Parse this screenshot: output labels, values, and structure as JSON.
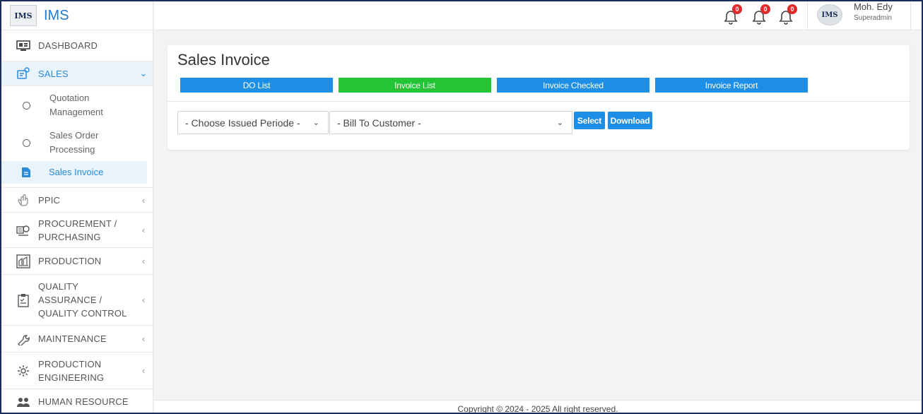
{
  "brand": {
    "logo_text": "IMS",
    "name": "IMS"
  },
  "sidebar": {
    "items": [
      {
        "label": "DASHBOARD",
        "icon": "monitor-icon"
      },
      {
        "label": "SALES",
        "icon": "sales-icon",
        "active": true
      },
      {
        "label": "PPIC",
        "icon": "hand-icon"
      },
      {
        "label": "PROCUREMENT / PURCHASING",
        "icon": "procurement-icon"
      },
      {
        "label": "PRODUCTION",
        "icon": "production-icon"
      },
      {
        "label": "QUALITY ASSURANCE / QUALITY CONTROL",
        "icon": "clipboard-icon"
      },
      {
        "label": "MAINTENANCE",
        "icon": "wrench-icon"
      },
      {
        "label": "PRODUCTION ENGINEERING",
        "icon": "gear-icon"
      },
      {
        "label": "HUMAN RESOURCE",
        "icon": "people-icon"
      }
    ],
    "sales_sub": [
      {
        "label": "Quotation Management"
      },
      {
        "label": "Sales Order Processing"
      },
      {
        "label": "Sales Invoice",
        "active": true
      }
    ]
  },
  "topbar": {
    "notifications": [
      {
        "count": "0"
      },
      {
        "count": "0"
      },
      {
        "count": "0"
      }
    ],
    "user": {
      "avatar_text": "IMS",
      "name": "Moh. Edy",
      "role": "Superadmin"
    }
  },
  "main": {
    "title": "Sales Invoice",
    "tabs": [
      {
        "label": "DO List",
        "active": false
      },
      {
        "label": "Invoice List",
        "active": true
      },
      {
        "label": "Invoice Checked",
        "active": false
      },
      {
        "label": "Invoice Report",
        "active": false
      }
    ],
    "filters": {
      "period": "- Choose Issued Periode -",
      "customer": "- Bill To Customer -"
    },
    "select_label": "Select",
    "download_label": "Download"
  },
  "footer": {
    "text": "Copyright © 2024 - 2025 All right reserved."
  },
  "colors": {
    "accent": "#1e8fe6",
    "active_tab": "#23c435",
    "badge": "#e02a2a"
  }
}
